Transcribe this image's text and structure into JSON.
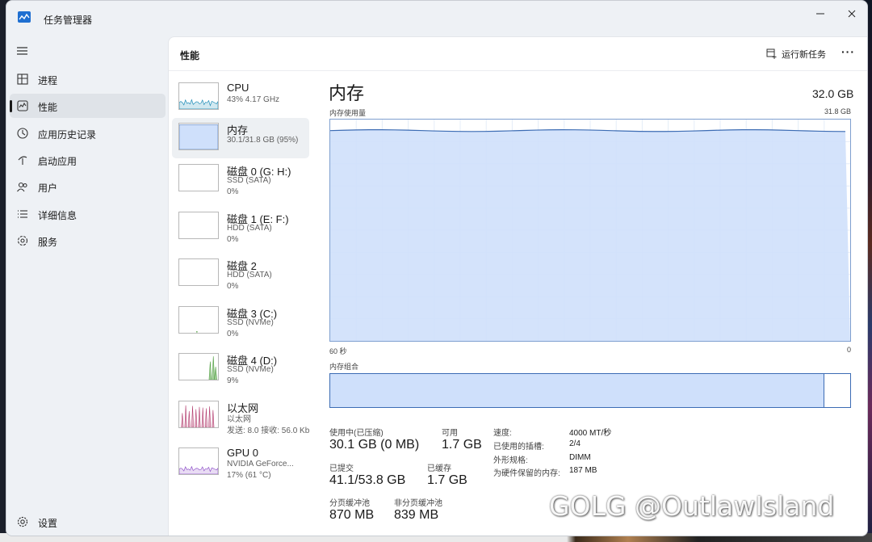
{
  "app": {
    "title": "任务管理器"
  },
  "nav": {
    "items": [
      {
        "label": "进程",
        "icon": "processes-icon"
      },
      {
        "label": "性能",
        "icon": "performance-icon",
        "active": true
      },
      {
        "label": "应用历史记录",
        "icon": "app-history-icon"
      },
      {
        "label": "启动应用",
        "icon": "startup-icon"
      },
      {
        "label": "用户",
        "icon": "users-icon"
      },
      {
        "label": "详细信息",
        "icon": "details-icon"
      },
      {
        "label": "服务",
        "icon": "services-icon"
      }
    ],
    "settings_label": "设置"
  },
  "header": {
    "title": "性能",
    "run_task_label": "运行新任务",
    "more_label": "···"
  },
  "devices": [
    {
      "name": "CPU",
      "sub1": "43% 4.17 GHz",
      "sub2": "",
      "sub3": "",
      "color": "#1a8ab5"
    },
    {
      "name": "内存",
      "sub1": "30.1/31.8 GB (95%)",
      "sub2": "",
      "sub3": "",
      "color": "#3c6cb4",
      "active": true
    },
    {
      "name": "磁盘 0 (G: H:)",
      "sub1": "SSD (SATA)",
      "sub2": "0%",
      "sub3": "",
      "color": "#4f9f3f"
    },
    {
      "name": "磁盘 1 (E: F:)",
      "sub1": "HDD (SATA)",
      "sub2": "0%",
      "sub3": "",
      "color": "#4f9f3f"
    },
    {
      "name": "磁盘 2",
      "sub1": "HDD (SATA)",
      "sub2": "0%",
      "sub3": "",
      "color": "#4f9f3f"
    },
    {
      "name": "磁盘 3 (C:)",
      "sub1": "SSD (NVMe)",
      "sub2": "0%",
      "sub3": "",
      "color": "#4f9f3f"
    },
    {
      "name": "磁盘 4 (D:)",
      "sub1": "SSD (NVMe)",
      "sub2": "9%",
      "sub3": "",
      "color": "#4f9f3f"
    },
    {
      "name": "以太网",
      "sub1": "以太网",
      "sub2": "发送: 8.0  接收: 56.0 Kb",
      "sub3": "",
      "color": "#b1386b"
    },
    {
      "name": "GPU 0",
      "sub1": "NVIDIA GeForce...",
      "sub2": "17% (61 °C)",
      "sub3": "",
      "color": "#8f52c9"
    }
  ],
  "detail": {
    "title": "内存",
    "total": "32.0 GB",
    "usage_label": "内存使用量",
    "usage_max": "31.8 GB",
    "time_left": "60 秒",
    "time_right": "0",
    "composition_label": "内存组合",
    "usage_fraction": 0.95,
    "stats": {
      "in_use_label": "使用中(已压缩)",
      "in_use_value": "30.1 GB (0 MB)",
      "available_label": "可用",
      "available_value": "1.7 GB",
      "committed_label": "已提交",
      "committed_value": "41.1/53.8 GB",
      "cached_label": "已缓存",
      "cached_value": "1.7 GB",
      "paged_label": "分页缓冲池",
      "paged_value": "870 MB",
      "nonpaged_label": "非分页缓冲池",
      "nonpaged_value": "839 MB"
    },
    "specs": [
      {
        "k": "速度:",
        "v": "4000 MT/秒"
      },
      {
        "k": "已使用的插槽:",
        "v": "2/4"
      },
      {
        "k": "外形规格:",
        "v": "DIMM"
      },
      {
        "k": "为硬件保留的内存:",
        "v": "187 MB"
      }
    ]
  },
  "watermark": "GOLG @OutlawIsland",
  "colors": {
    "memory_fill": "#cfe0fb",
    "memory_line": "#3c6cb4"
  }
}
